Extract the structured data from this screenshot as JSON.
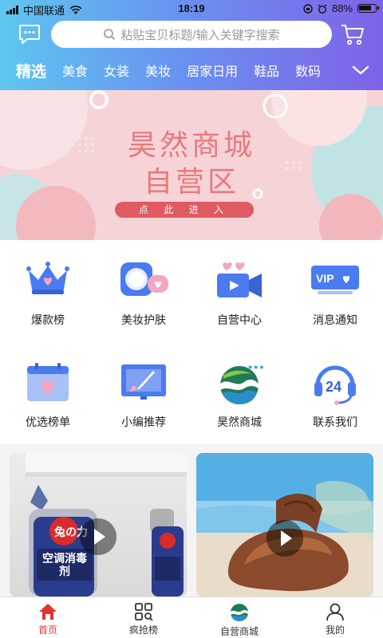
{
  "status_bar": {
    "carrier": "中国联通",
    "time": "18:19",
    "battery": "88%"
  },
  "search": {
    "placeholder": "粘贴宝贝标题/输入关键字搜索"
  },
  "categories": [
    "精选",
    "美食",
    "女装",
    "美妆",
    "居家日用",
    "鞋品",
    "数码"
  ],
  "banner": {
    "line1": "昊然商城",
    "line2": "自营区",
    "button": "点 此 进 入"
  },
  "grid": [
    {
      "label": "爆款榜",
      "icon": "crown-icon"
    },
    {
      "label": "美妆护肤",
      "icon": "compact-mirror-icon"
    },
    {
      "label": "自营中心",
      "icon": "video-camera-icon"
    },
    {
      "label": "消息通知",
      "icon": "vip-card-icon"
    },
    {
      "label": "优选榜单",
      "icon": "calendar-heart-icon"
    },
    {
      "label": "小编推荐",
      "icon": "paint-brush-icon"
    },
    {
      "label": "昊然商城",
      "icon": "wave-globe-icon"
    },
    {
      "label": "联系我们",
      "icon": "headset-24-icon"
    }
  ],
  "products": {
    "left_brand": "兔の力",
    "left_text": "空调消毒剂",
    "right_item": "sandal"
  },
  "tabbar": [
    {
      "label": "首页",
      "active": true
    },
    {
      "label": "疯抢榜",
      "active": false
    },
    {
      "label": "自营商城",
      "active": false
    },
    {
      "label": "我的",
      "active": false
    }
  ],
  "colors": {
    "accent": "#e33333",
    "header_start": "#5ec6f0",
    "header_end": "#7f62e8",
    "icon_blue": "#4a7bf0",
    "icon_pink": "#f3a6c1"
  }
}
